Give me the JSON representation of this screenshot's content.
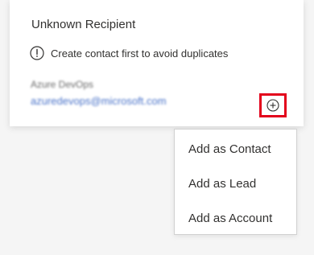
{
  "card": {
    "title": "Unknown Recipient",
    "warning": "Create contact first to avoid duplicates",
    "contact_name": "Azure DevOps",
    "contact_email": "azuredevops@microsoft.com"
  },
  "menu": {
    "items": [
      {
        "label": "Add as Contact"
      },
      {
        "label": "Add as Lead"
      },
      {
        "label": "Add as Account"
      }
    ]
  },
  "colors": {
    "highlight": "#e3001b",
    "text": "#323130",
    "email": "#4a73c9"
  }
}
